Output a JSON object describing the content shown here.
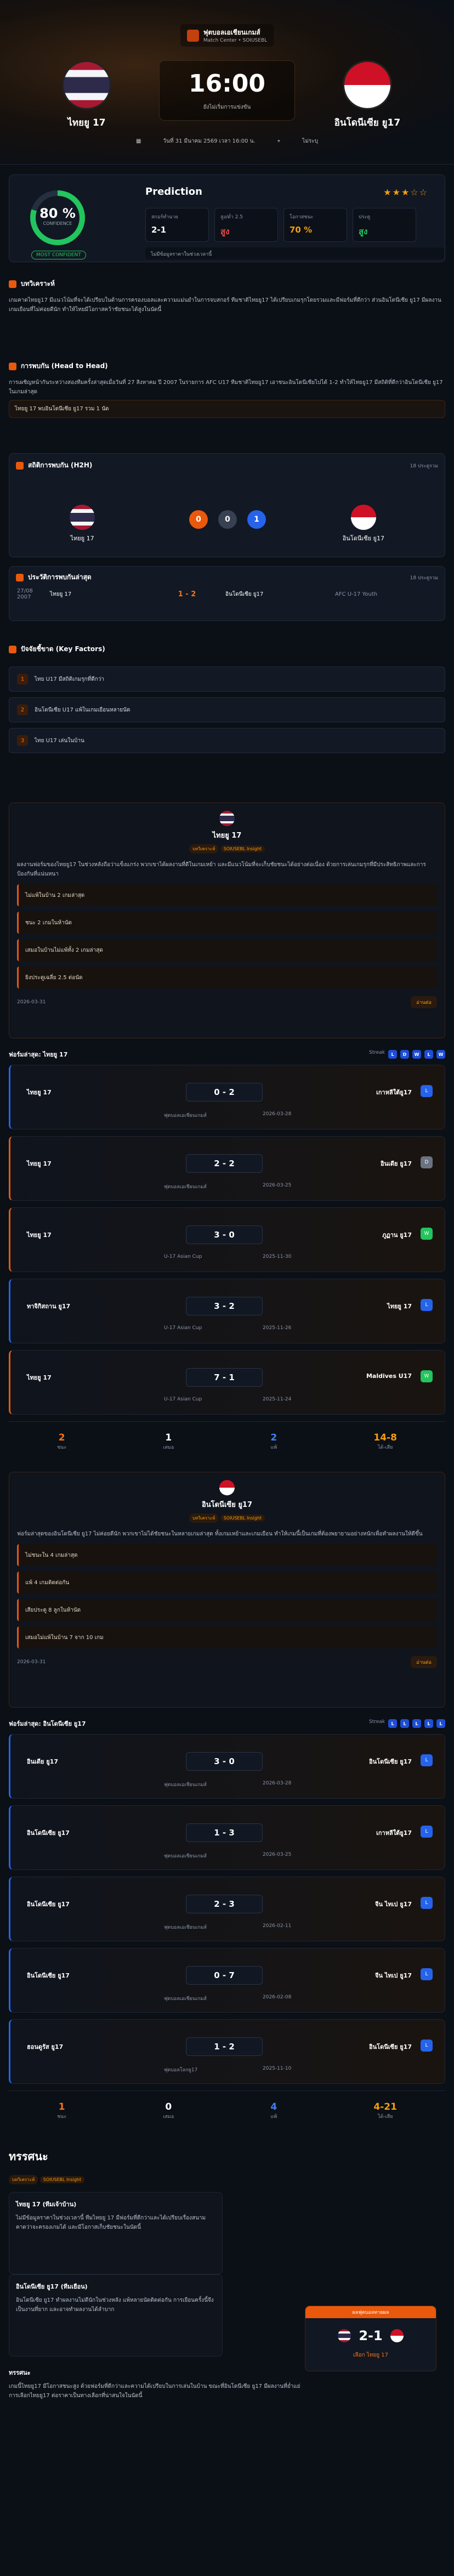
{
  "league": {
    "name": "ฟุตบอลเอเชียนเกมส์",
    "sub": "Match Center • SOIUSEBL"
  },
  "home": {
    "name": "ไทยยู 17"
  },
  "away": {
    "name": "อินโดนีเซีย ยู17"
  },
  "kickoff": {
    "time": "16:00",
    "status": "ยังไม่เริ่มการแข่งขัน",
    "date": "วันที่ 31 มีนาคม 2569 เวลา 16:00 น.",
    "venue": "ไม่ระบุ"
  },
  "prediction": {
    "title": "Prediction",
    "confidence": "80 %",
    "confidence_label": "CONFIDENCE",
    "badge": "MOST CONFIDENT",
    "stars": "★★★☆☆",
    "boxes": [
      {
        "label": "สกอร์ทำนาย",
        "value": "2-1",
        "color": "#ffffff"
      },
      {
        "label": "สูง/ต่ำ 2.5",
        "value": "สูง",
        "color": "#ef4444"
      },
      {
        "label": "โอกาสชนะ",
        "value": "70 %",
        "color": "#f59e0b"
      },
      {
        "label": "ประตู",
        "value": "สูง",
        "color": "#22c55e"
      }
    ],
    "note": "ไม่มีข้อมูลราคาในช่วงเวลานี้"
  },
  "summary": {
    "title": "บทวิเคราะห์",
    "text": "เกมคาดไทยยู17 มีแนวโน้มที่จะได้เปรียบในด้านการครองบอลและความแม่นยำในการจบสกอร์ ทีมชาติไทยยู17 ได้เปรียบเกมรุกโดยรวมและมีฟอร์มที่ดีกว่า ส่วนอินโดนีเซีย ยู17 มีผลงานเกมเยือนที่ไม่ค่อยดีนัก ทำให้ไทยมีโอกาสคว้าชัยชนะได้สูงในนัดนี้"
  },
  "h2h_analysis": {
    "title": "การพบกัน (Head to Head)",
    "text": "การเผชิญหน้ากันระหว่างสองทีมครั้งล่าสุดเมื่อวันที่ 27 สิงหาคม ปี 2007 ในรายการ AFC U17 ทีมชาติไทยยู17 เอาชนะอินโดนีเซียไปได้ 1-2 ทำให้ไทยยู17 มีสถิติที่ดีกว่าอินโดนีเซีย ยู17 ในเกมล่าสุด",
    "pill": "ไทยยู 17 พบอินโดนีเซีย ยู17 รวม 1 นัด"
  },
  "h2h_stats": {
    "title": "สถิติการพบกัน (H2H)",
    "sub": "18 ประตูรวม",
    "home_wins": "0",
    "draws": "0",
    "away_wins": "1",
    "home_label": "ชนะ",
    "draw_label": "เสมอ",
    "away_label": "ชนะ"
  },
  "h2h_list": {
    "title": "ประวัติการพบกันล่าสุด",
    "sub": "18 ประตูรวม",
    "date": "27/08 2007",
    "home": "ไทยยู 17",
    "score": "1 - 2",
    "away": "อินโดนีเซีย ยู17",
    "comp": "AFC U-17 Youth"
  },
  "key_factors": {
    "title": "ปัจจัยชี้ขาด (Key Factors)",
    "items": [
      "ไทย U17 มีสถิติเกมรุกที่ดีกว่า",
      "อินโดนีเซีย U17 แพ้ในเกมเยือนหลายนัด",
      "ไทย U17 เล่นในบ้าน"
    ]
  },
  "home_panel": {
    "name": "ไทยยู 17",
    "tag1": "บทวิเคราะห์",
    "tag2": "SOIUSEBL Insight",
    "text": "ผลงานฟอร์มของไทยยู17 ในช่วงหลังถือว่าแข็งแกร่ง พวกเขาได้ผลงานที่ดีในเกมเหย้า และมีแนวโน้มที่จะเก็บชัยชนะได้อย่างต่อเนื่อง ด้วยการเล่นเกมรุกที่มีประสิทธิภาพและการป้องกันที่แน่นหนา",
    "bullets": [
      "ไม่แพ้ในบ้าน 2 เกมล่าสุด",
      "ชนะ 2 เกมในห้านัด",
      "เสมอในบ้านไม่แพ้ทั้ง 2 เกมล่าสุด",
      "ยิงประตูเฉลี่ย 2.5 ต่อนัด"
    ],
    "date": "2026-03-31",
    "more": "อ่านต่อ"
  },
  "home_form": {
    "title": "ฟอร์มล่าสุด: ไทยยู 17",
    "streak_label": "Streak",
    "streak": [
      "L",
      "D",
      "W",
      "L",
      "W"
    ],
    "matches": [
      {
        "home": "ไทยยู 17",
        "score": "0 - 2",
        "away": "เกาหลีใต้ยู17",
        "res": "L",
        "comp": "ฟุตบอลเอเชียนเกมส์",
        "date": "2026-03-28"
      },
      {
        "home": "ไทยยู 17",
        "score": "2 - 2",
        "away": "อินเดีย ยู17",
        "res": "D",
        "comp": "ฟุตบอลเอเชียนเกมส์",
        "date": "2026-03-25"
      },
      {
        "home": "ไทยยู 17",
        "score": "3 - 0",
        "away": "ภูฏาน ยู17",
        "res": "W",
        "comp": "U-17 Asian Cup",
        "date": "2025-11-30"
      },
      {
        "home": "ทาจิกิสถาน ยู17",
        "score": "3 - 2",
        "away": "ไทยยู 17",
        "res": "L",
        "comp": "U-17 Asian Cup",
        "date": "2025-11-26"
      },
      {
        "home": "ไทยยู 17",
        "score": "7 - 1",
        "away": "Maldives U17",
        "res": "W",
        "comp": "U-17 Asian Cup",
        "date": "2025-11-24"
      }
    ],
    "sum": [
      {
        "v": "2",
        "l": "ชนะ"
      },
      {
        "v": "1",
        "l": "เสมอ"
      },
      {
        "v": "2",
        "l": "แพ้"
      },
      {
        "v": "14-8",
        "l": "ได้-เสีย"
      }
    ]
  },
  "away_panel": {
    "name": "อินโดนีเซีย ยู17",
    "tag1": "บทวิเคราะห์",
    "tag2": "SOIUSEBL Insight",
    "text": "ฟอร์มล่าสุดของอินโดนีเซีย ยู17 ไม่ค่อยดีนัก พวกเขาไม่ได้ชัยชนะในหลายเกมล่าสุด ทั้งเกมเหย้าและเกมเยือน ทำให้เกมนี้เป็นเกมที่ต้องพยายามอย่างหนักเพื่อทำผลงานให้ดีขึ้น",
    "bullets": [
      "ไม่ชนะใน 4 เกมล่าสุด",
      "แพ้ 4 เกมติดต่อกัน",
      "เสียประตู 8 ลูกในห้านัด",
      "เสมอไม่แพ้ในบ้าน 7 จาก 10 เกม"
    ],
    "date": "2026-03-31",
    "more": "อ่านต่อ"
  },
  "away_form": {
    "title": "ฟอร์มล่าสุด: อินโดนีเซีย ยู17",
    "streak_label": "Streak",
    "streak": [
      "L",
      "L",
      "L",
      "L",
      "L"
    ],
    "matches": [
      {
        "home": "อินเดีย ยู17",
        "score": "3 - 0",
        "away": "อินโดนีเซีย ยู17",
        "res": "L",
        "comp": "ฟุตบอลเอเชียนเกมส์",
        "date": "2026-03-28"
      },
      {
        "home": "อินโดนีเซีย ยู17",
        "score": "1 - 3",
        "away": "เกาหลีใต้ยู17",
        "res": "L",
        "comp": "ฟุตบอลเอเชียนเกมส์",
        "date": "2026-03-25"
      },
      {
        "home": "อินโดนีเซีย ยู17",
        "score": "2 - 3",
        "away": "จีน ไทเป ยู17",
        "res": "L",
        "comp": "ฟุตบอลเอเชียนเกมส์",
        "date": "2026-02-11"
      },
      {
        "home": "อินโดนีเซีย ยู17",
        "score": "0 - 7",
        "away": "จีน ไทเป ยู17",
        "res": "L",
        "comp": "ฟุตบอลเอเชียนเกมส์",
        "date": "2026-02-08"
      },
      {
        "home": "ฮอนดูรัส ยู17",
        "score": "1 - 2",
        "away": "อินโดนีเซีย ยู17",
        "res": "L",
        "comp": "ฟุตบอลโลกยู17",
        "date": "2025-11-10"
      }
    ],
    "sum": [
      {
        "v": "1",
        "l": "ชนะ"
      },
      {
        "v": "0",
        "l": "เสมอ"
      },
      {
        "v": "4",
        "l": "แพ้"
      },
      {
        "v": "4-21",
        "l": "ได้-เสีย"
      }
    ]
  },
  "conclusion": {
    "title": "ทรรศนะ",
    "tag1": "บทวิเคราะห์",
    "tag2": "SOIUSEBL Insight",
    "home_title": "ไทยยู 17 (ทีมเจ้าบ้าน)",
    "home_text": "ไม่มีข้อมูลราคาในช่วงเวลานี้ ทีมไทยยู 17 มีฟอร์มที่ดีกว่าและได้เปรียบเรื่องสนาม คาดว่าจะครองเกมได้ และมีโอกาสเก็บชัยชนะในนัดนี้",
    "away_title": "อินโดนีเซีย ยู17 (ทีมเยือน)",
    "away_text": "อินโดนีเซีย ยู17 ทำผลงานไม่ดีนักในช่วงหลัง แพ้หลายนัดติดต่อกัน การเยือนครั้งนี้จึงเป็นงานที่ยาก และอาจทำผลงานได้ลำบาก",
    "final_title": "ทรรศนะ",
    "final_text": "เกมนี้ไทยยู17 มีโอกาสชนะสูง ด้วยฟอร์มที่ดีกว่าและความได้เปรียบในการเล่นในบ้าน ขณะที่อินโดนีเซีย ยู17 มีผลงานที่ย่ำแย่ การเลือกไทยยู17 ต่อราคาเป็นทางเลือกที่น่าสนใจในนัดนี้",
    "pick_label": "ผลฟุตบอลทายผล",
    "pick_score": "2-1",
    "pick_team": "เลือก ไทยยู 17"
  }
}
